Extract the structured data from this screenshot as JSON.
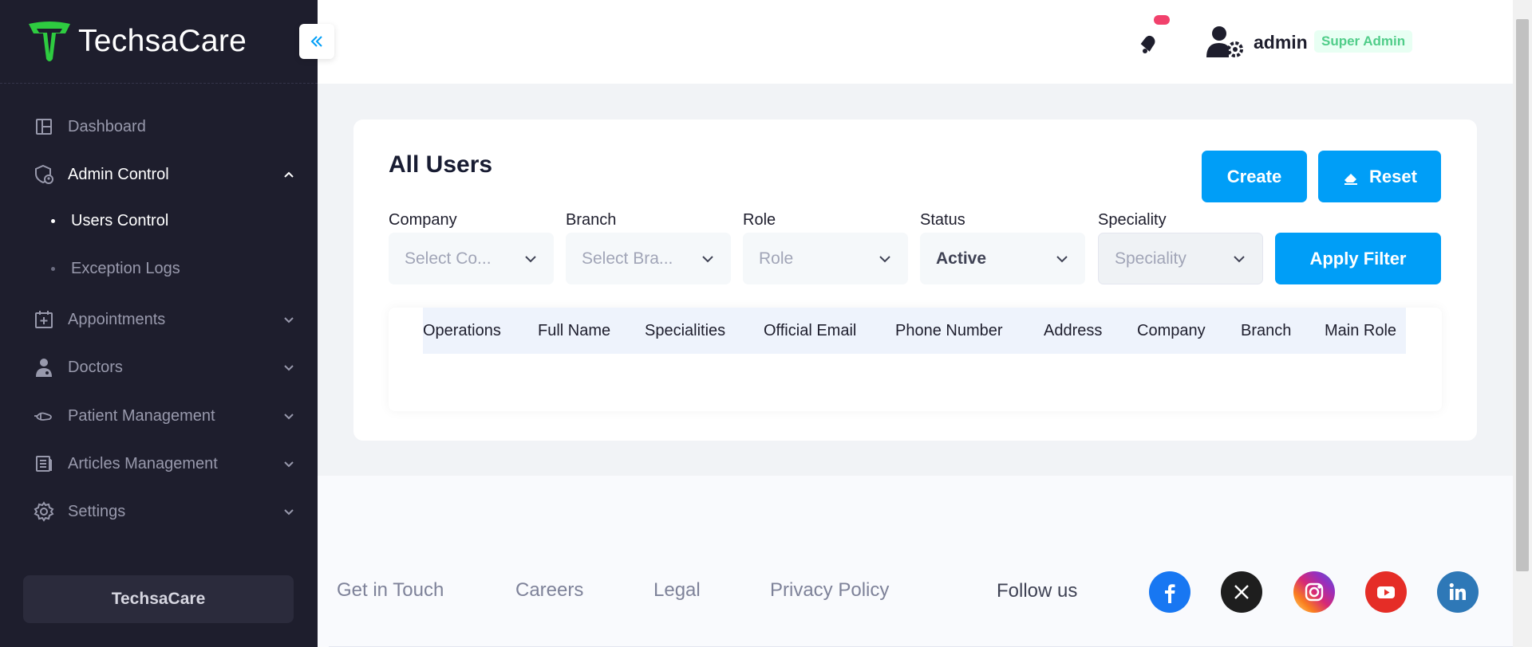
{
  "app": {
    "logo_text": "TechsaCare"
  },
  "sidebar": {
    "items": [
      {
        "label": "Dashboard"
      },
      {
        "label": "Admin Control"
      },
      {
        "label": "Appointments"
      },
      {
        "label": "Doctors"
      },
      {
        "label": "Patient Management"
      },
      {
        "label": "Articles Management"
      },
      {
        "label": "Settings"
      }
    ],
    "sub_items": [
      {
        "label": "Users Control"
      },
      {
        "label": "Exception Logs"
      }
    ],
    "footer_button": "TechsaCare"
  },
  "header": {
    "user_name": "admin",
    "user_role": "Super Admin"
  },
  "main": {
    "title": "All Users",
    "create_label": "Create",
    "reset_label": "Reset",
    "apply_label": "Apply Filter",
    "filters": [
      {
        "label": "Company",
        "value": "Select Co..."
      },
      {
        "label": "Branch",
        "value": "Select Bra..."
      },
      {
        "label": "Role",
        "value": "Role"
      },
      {
        "label": "Status",
        "value": "Active"
      },
      {
        "label": "Speciality",
        "value": "Speciality"
      }
    ],
    "table_headers": [
      "Operations",
      "Full Name",
      "Specialities",
      "Official Email",
      "Phone Number",
      "Address",
      "Company",
      "Branch",
      "Main Role"
    ]
  },
  "footer": {
    "links": [
      "Get in Touch",
      "Careers",
      "Legal",
      "Privacy Policy"
    ],
    "follow_label": "Follow us",
    "social": [
      "facebook-icon",
      "x-icon",
      "instagram-icon",
      "youtube-icon",
      "linkedin-icon"
    ]
  },
  "colors": {
    "sidebar_bg": "#1e1e2d",
    "primary": "#009ef7",
    "badge_green": "#50cd89",
    "notification_badge": "#f1416c"
  }
}
